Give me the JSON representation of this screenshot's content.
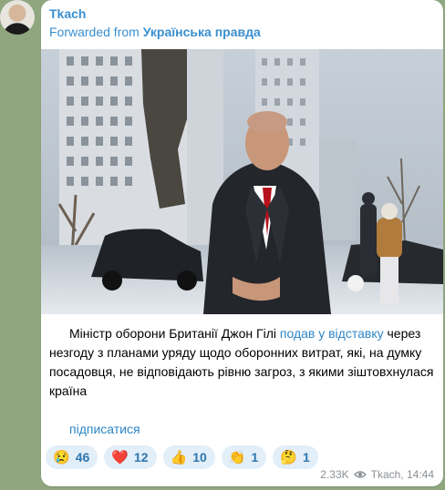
{
  "sender": {
    "name": "Tkach"
  },
  "forwarded": {
    "prefix": "Forwarded from",
    "channel": "Українська правда"
  },
  "photo": {
    "description_icon": "photo-image"
  },
  "message": {
    "part1": "Міністр оборони Британії Джон Гілі ",
    "link": "подав у відставку",
    "part2": " через незгоду з планами уряду щодо оборонних витрат, які, на думку посадовця, не відповідають рівню загроз, з якими зіштовхнулася країна"
  },
  "subscribe_link": "підписатися",
  "reactions": [
    {
      "emoji": "😢",
      "count": "46"
    },
    {
      "emoji": "❤️",
      "count": "12"
    },
    {
      "emoji": "👍",
      "count": "10"
    },
    {
      "emoji": "👏",
      "count": "1"
    },
    {
      "emoji": "🤔",
      "count": "1"
    }
  ],
  "meta": {
    "views": "2.33K",
    "signature": "Tkach, 14:44"
  },
  "colors": {
    "accent": "#3a8fd0",
    "link": "#2e86c7",
    "reaction_bg": "#e2eef8",
    "background": "#8fa67e"
  }
}
